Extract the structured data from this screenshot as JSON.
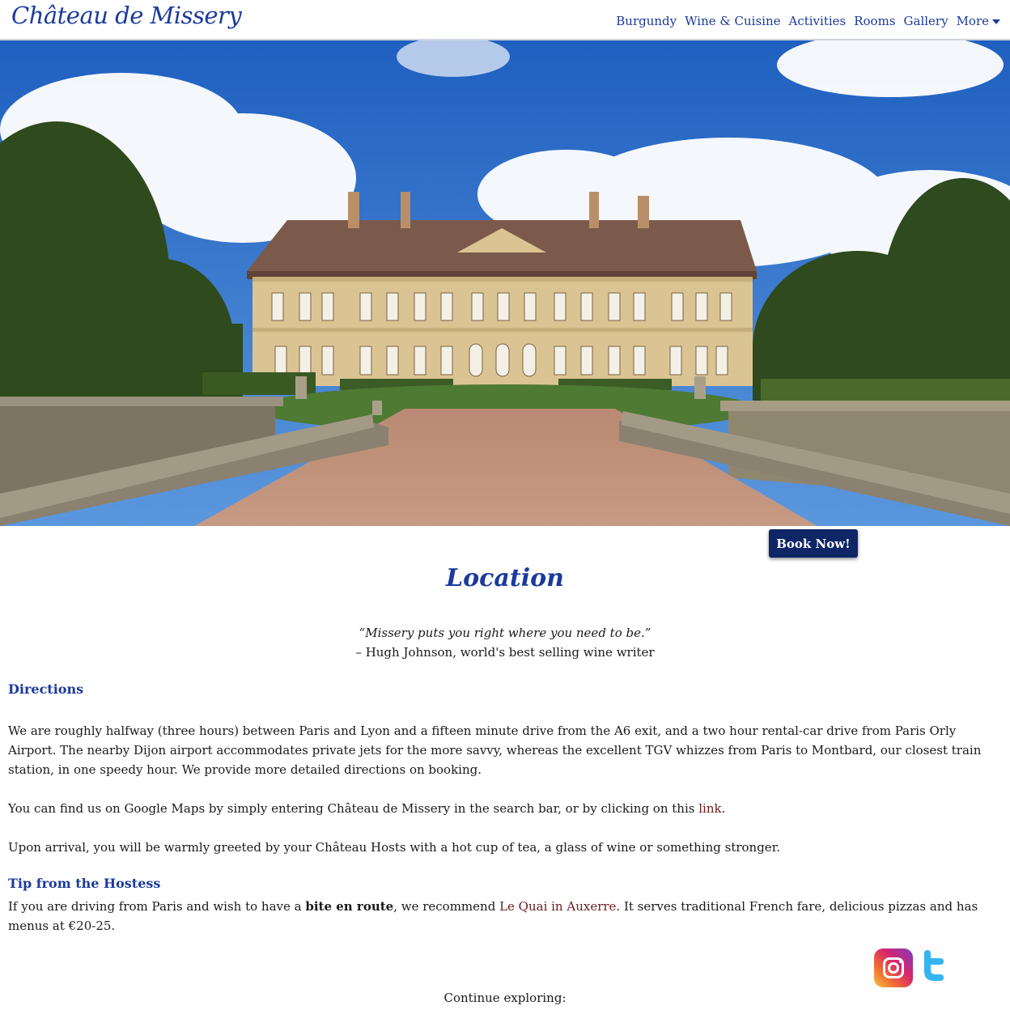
{
  "header": {
    "logo": "Château de Missery",
    "nav": [
      "Burgundy",
      "Wine & Cuisine",
      "Activities",
      "Rooms",
      "Gallery",
      "More"
    ]
  },
  "book_button": "Book Now!",
  "page_title": "Location",
  "quote": {
    "text": "“Missery puts you right where you need to be.”",
    "attribution": "– Hugh Johnson, world's best selling wine writer"
  },
  "directions": {
    "heading": "Directions",
    "p1": "We are roughly halfway (three hours) between Paris and Lyon and a fifteen minute drive from the A6 exit, and a two hour rental-car drive from Paris Orly Airport. The nearby Dijon airport accommodates private jets for the more savvy, whereas the excellent TGV whizzes from Paris to Montbard, our closest train station, in one speedy hour. We provide more detailed directions on booking.",
    "p2_before": "You can find us on Google Maps by simply entering Château de Missery in the search bar, or by clicking on this ",
    "p2_link": "link",
    "p2_after": ".",
    "p3": "Upon arrival, you will be warmly greeted by your Château Hosts with a hot cup of tea, a glass of wine or something stronger."
  },
  "tip": {
    "heading": "Tip from the Hostess",
    "before": "If you are driving from Paris and wish to have a ",
    "bold": "bite en route",
    "middle": ", we recommend ",
    "link": "Le Quai in Auxerre",
    "after": ". It serves traditional French fare, delicious pizzas and has menus at €20-25."
  },
  "social": [
    "instagram-icon",
    "twitter-icon"
  ],
  "continue_text": "Continue exploring:",
  "colors": {
    "brand_blue": "#1b3a9b",
    "button_navy": "#0f2666",
    "link_maroon": "#6b1c1c"
  }
}
